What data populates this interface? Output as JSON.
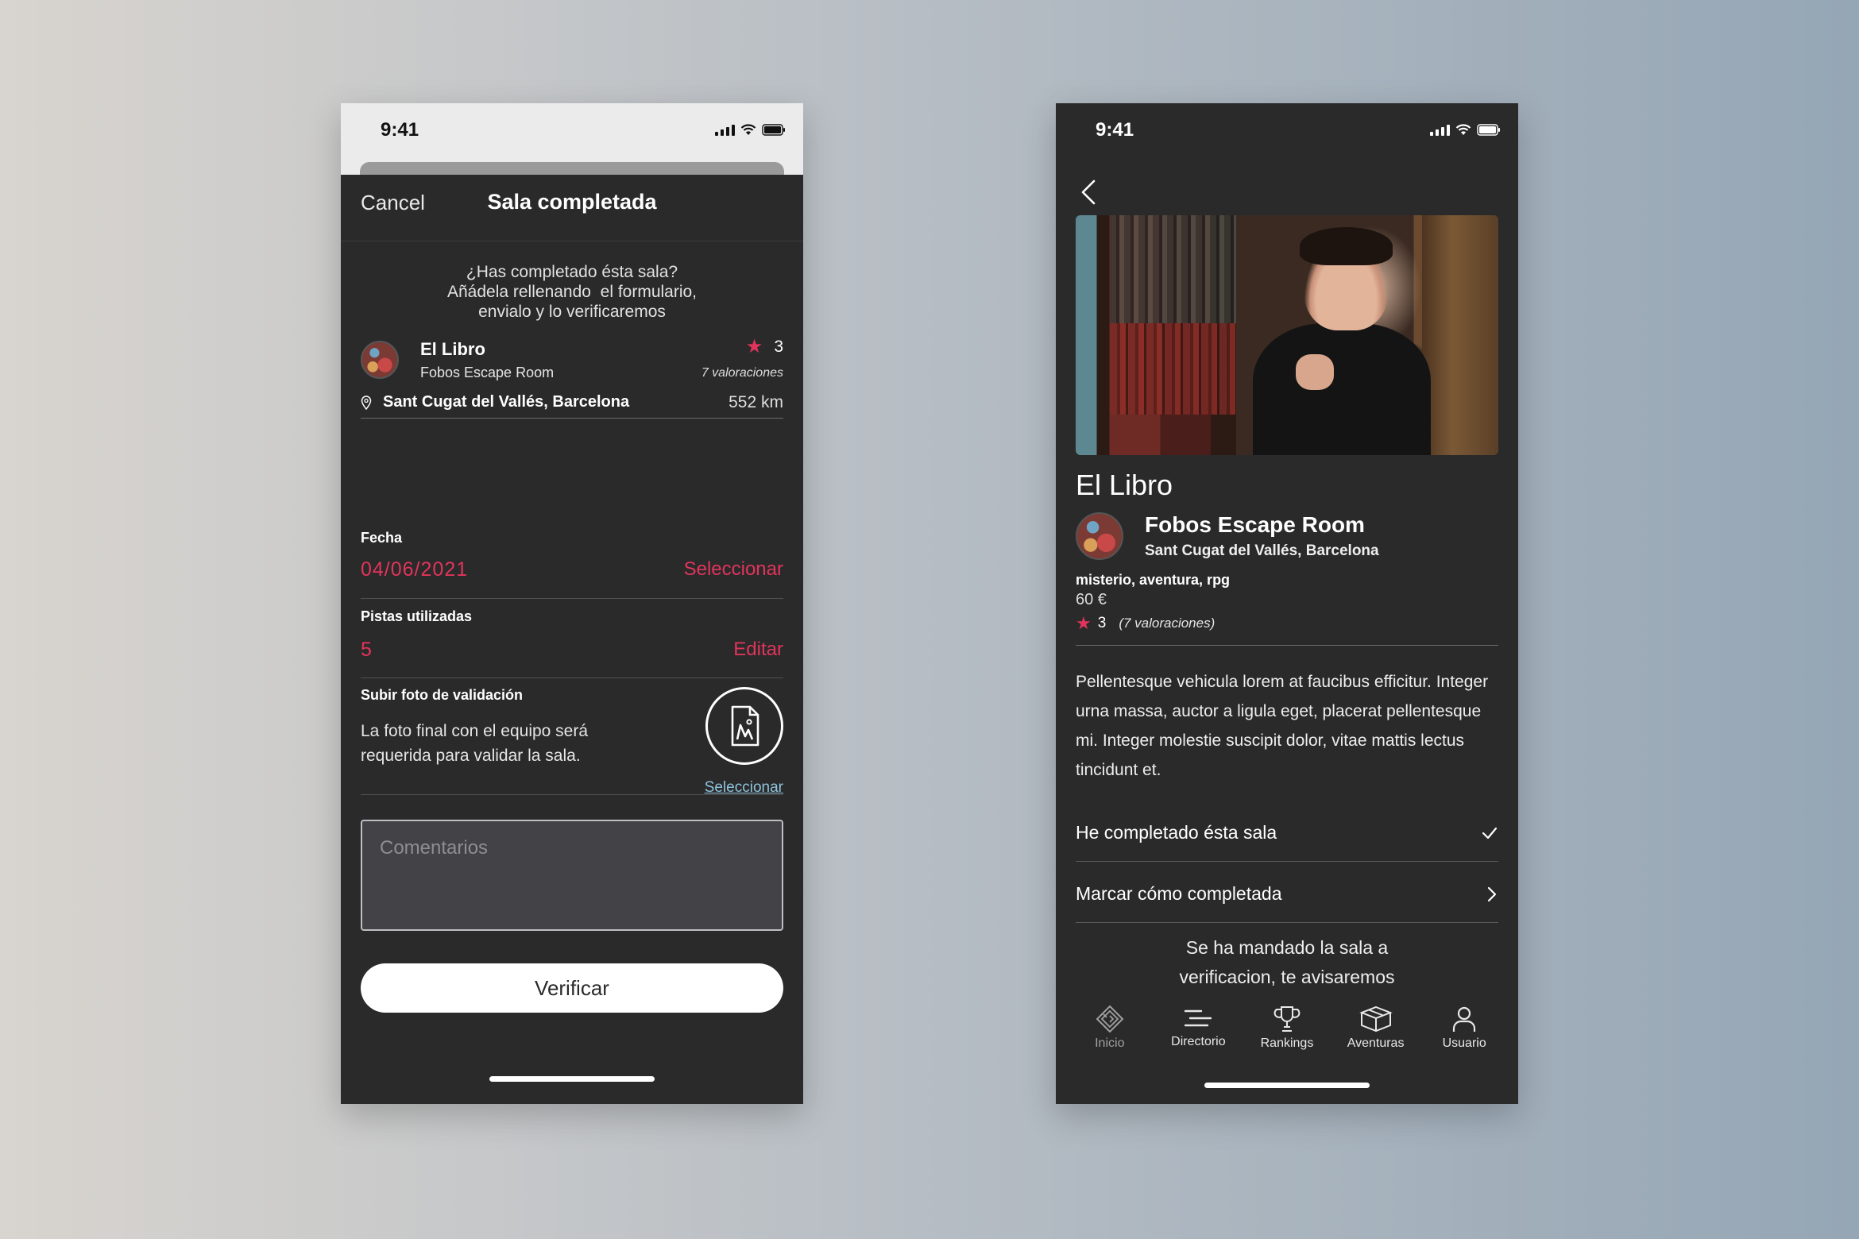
{
  "left_phone": {
    "status": {
      "time": "9:41"
    },
    "header": {
      "cancel_label": "Cancel",
      "title": "Sala completada"
    },
    "intro": [
      "¿Has completado ésta sala?",
      "Añádela rellenando  el formulario,",
      "envialo y lo verificaremos"
    ],
    "room": {
      "name": "El Libro",
      "company": "Fobos Escape Room",
      "rating": "3",
      "reviews": "7 valoraciones",
      "location": "Sant Cugat del Vallés, Barcelona",
      "distance": "552 km"
    },
    "fecha": {
      "label": "Fecha",
      "value": "04/06/2021",
      "action": "Seleccionar"
    },
    "pistas": {
      "label": "Pistas utilizadas",
      "value": "5",
      "action": "Editar"
    },
    "foto": {
      "label": "Subir foto de validación",
      "description": "La foto final con el equipo será requerida para validar la sala.",
      "action": "Seleccionar"
    },
    "comments": {
      "placeholder": "Comentarios"
    },
    "verify_label": "Verificar"
  },
  "right_phone": {
    "status": {
      "time": "9:41"
    },
    "title": "El Libro",
    "company": {
      "name": "Fobos Escape Room",
      "location": "Sant Cugat del Vallés, Barcelona"
    },
    "tags": "misterio, aventura, rpg",
    "price": "60 €",
    "rating": "3",
    "reviews": "(7 valoraciones)",
    "description": "Pellentesque vehicula lorem at faucibus efficitur. Integer urna massa, auctor a ligula eget, placerat pellentesque mi. Integer molestie suscipit dolor, vitae mattis lectus tincidunt et.",
    "rows": [
      {
        "label": "He completado ésta sala",
        "icon": "check-icon"
      },
      {
        "label": "Marcar cómo completada",
        "icon": "chevron-right-icon"
      }
    ],
    "notice": [
      "Se ha mandado la sala a",
      "verificacion, te avisaremos"
    ],
    "tabs": [
      {
        "label": "Inicio",
        "icon": "maze-icon"
      },
      {
        "label": "Directorio",
        "icon": "list-icon"
      },
      {
        "label": "Rankings",
        "icon": "trophy-icon"
      },
      {
        "label": "Aventuras",
        "icon": "box-icon"
      },
      {
        "label": "Usuario",
        "icon": "user-icon"
      }
    ]
  },
  "colors": {
    "accent": "#e2345b",
    "link": "#8fc4dc",
    "surface": "#2a2a2b"
  }
}
